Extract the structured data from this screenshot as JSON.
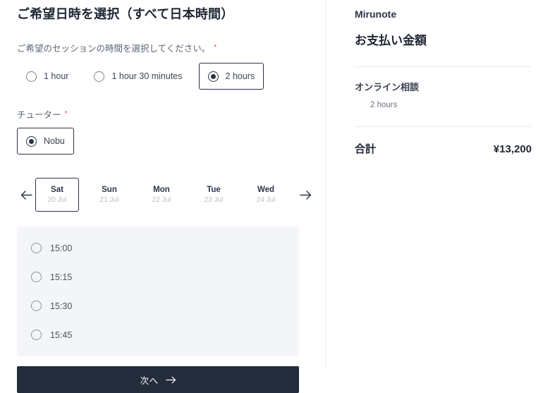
{
  "left": {
    "page_title": "ご希望日時を選択（すべて日本時間）",
    "duration": {
      "label": "ご希望のセッションの時間を選択してください。",
      "required_marker": "*",
      "options": [
        {
          "label": "1 hour",
          "selected": false
        },
        {
          "label": "1 hour 30 minutes",
          "selected": false
        },
        {
          "label": "2 hours",
          "selected": true
        }
      ]
    },
    "tutor": {
      "label": "チューター",
      "required_marker": "*",
      "options": [
        {
          "label": "Nobu",
          "selected": true
        }
      ]
    },
    "dates": {
      "prev_icon": "arrow-left-icon",
      "next_icon": "arrow-right-icon",
      "items": [
        {
          "dow": "Sat",
          "day": "20 Jul",
          "selected": true
        },
        {
          "dow": "Sun",
          "day": "21 Jul",
          "selected": false
        },
        {
          "dow": "Mon",
          "day": "22 Jul",
          "selected": false
        },
        {
          "dow": "Tue",
          "day": "23 Jul",
          "selected": false
        },
        {
          "dow": "Wed",
          "day": "24 Jul",
          "selected": false
        }
      ]
    },
    "slots": [
      {
        "time": "15:00",
        "selected": false
      },
      {
        "time": "15:15",
        "selected": false
      },
      {
        "time": "15:30",
        "selected": false
      },
      {
        "time": "15:45",
        "selected": false
      }
    ],
    "next_button": {
      "label": "次へ",
      "icon": "arrow-right-icon"
    }
  },
  "right": {
    "brand": "Mirunote",
    "payment_title": "お支払い金額",
    "line_item": {
      "name": "オンライン相談",
      "detail": "2 hours"
    },
    "total": {
      "label": "合計",
      "value": "¥13,200"
    }
  },
  "colors": {
    "ink": "#2b3445",
    "button_bg": "#232c3b",
    "slots_bg": "#f3f5f8",
    "required": "#f0504d",
    "muted": "#b9bec7"
  }
}
